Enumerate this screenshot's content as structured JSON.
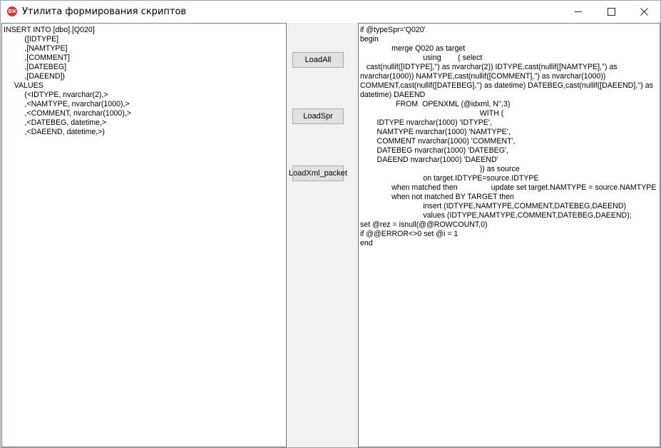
{
  "window": {
    "title": "Утилита формирования скриптов",
    "icon_text": "DX"
  },
  "buttons": {
    "load_all": "LoadAll",
    "load_spr": "LoadSpr",
    "load_xml_packet": "LoadXml_packet"
  },
  "left_editor": {
    "text": "INSERT INTO [dbo].[Q020]\n          ([IDTYPE]\n          ,[NAMTYPE]\n          ,[COMMENT]\n          ,[DATEBEG]\n          ,[DAEEND])\n     VALUES\n          (<IDTYPE, nvarchar(2),>\n          ,<NAMTYPE, nvarchar(1000),>\n          ,<COMMENT, nvarchar(1000),>\n          ,<DATEBEG, datetime,>\n          ,<DAEEND, datetime,>)"
  },
  "right_editor": {
    "text": "if @typeSpr='Q020'\nbegin\n               merge Q020 as target\n                              using        ( select\n   cast(nullif([IDTYPE],'') as nvarchar(2)) IDTYPE,cast(nullif([NAMTYPE],'') as nvarchar(1000)) NAMTYPE,cast(nullif([COMMENT],'') as nvarchar(1000)) COMMENT,cast(nullif([DATEBEG],'') as datetime) DATEBEG,cast(nullif([DAEEND],'') as datetime) DAEEND\n                 FROM  OPENXML (@idxml, N'',3)\n                                                         WITH (\n        IDTYPE nvarchar(1000) 'IDTYPE',\n        NAMTYPE nvarchar(1000) 'NAMTYPE',\n        COMMENT nvarchar(1000) 'COMMENT',\n        DATEBEG nvarchar(1000) 'DATEBEG',\n        DAEEND nvarchar(1000) 'DAEEND'\n                                                         )) as source\n                              on target.IDTYPE=source.IDTYPE\n               when matched then                update set target.NAMTYPE = source.NAMTYPE\n               when not matched BY TARGET then\n                              insert (IDTYPE,NAMTYPE,COMMENT,DATEBEG,DAEEND)\n                              values (IDTYPE,NAMTYPE,COMMENT,DATEBEG,DAEEND);\nset @rez = isnull(@@ROWCOUNT,0)\nif @@ERROR<>0 set @i = 1\nend"
  }
}
